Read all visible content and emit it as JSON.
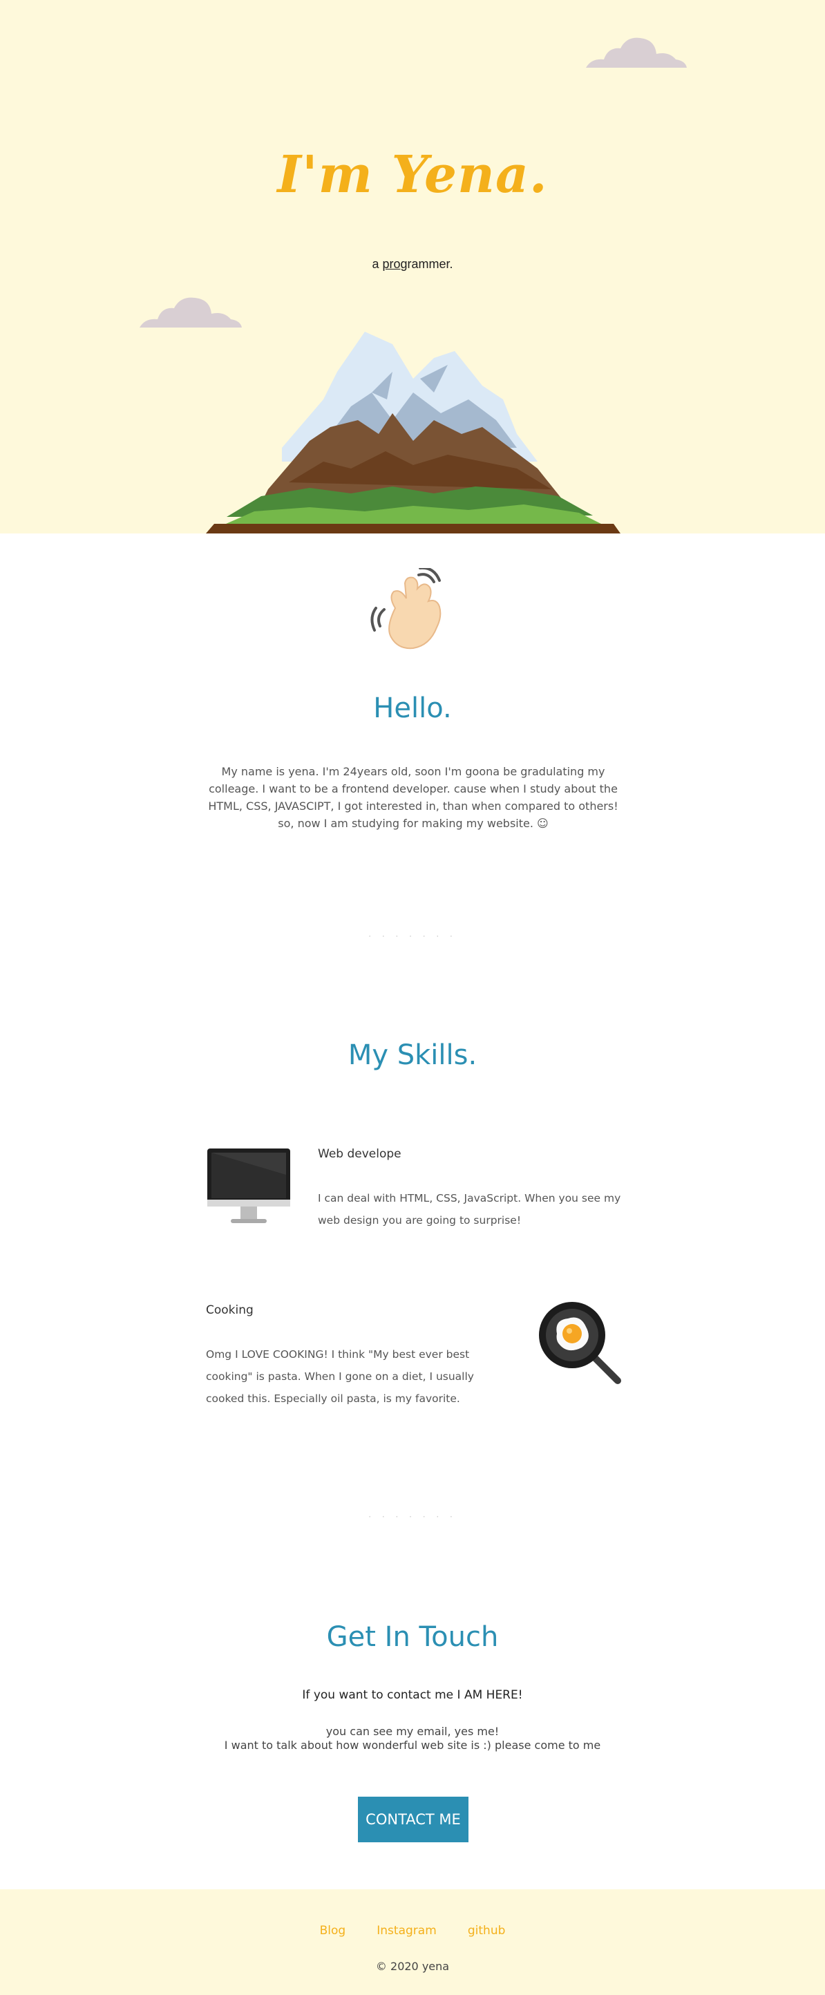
{
  "hero": {
    "title": "I'm Yena.",
    "subtitle_prefix": "a ",
    "subtitle_underline": "pro",
    "subtitle_suffix": "grammer."
  },
  "hello": {
    "title": "Hello.",
    "text": "My name is yena. I'm 24years old, soon I'm goona be gradulating my colleage. I want to be a frontend developer. cause when I study about the HTML, CSS, JAVASCIPT, I got interested in, than when compared to others! so, now I am studying for making my website. ☺"
  },
  "divider": "· · · · · · ·",
  "skills": {
    "title": "My Skills.",
    "items": [
      {
        "title": "Web develope",
        "desc": "I can deal with HTML, CSS, JavaScript. When you see my web design you are going to surprise!",
        "icon": "desktop-monitor-icon"
      },
      {
        "title": "Cooking",
        "desc": "Omg I LOVE COOKING! I think \"My best ever best cooking\" is pasta. When I gone on a diet, I usually cooked this. Especially oil pasta, is my favorite.",
        "icon": "frying-pan-egg-icon"
      }
    ]
  },
  "contact": {
    "title": "Get In Touch",
    "lead": "If you want to contact me I AM HERE!",
    "line1": "you can see my email, yes me!",
    "line2": "I want to talk about how wonderful web site is :) please come to me",
    "button": "CONTACT ME"
  },
  "footer": {
    "links": [
      "Blog",
      "Instagram",
      "github"
    ],
    "copyright": "© 2020 yena"
  },
  "colors": {
    "hero_bg": "#fef9db",
    "accent_yellow": "#f4b01b",
    "accent_blue": "#2b8fb3"
  }
}
